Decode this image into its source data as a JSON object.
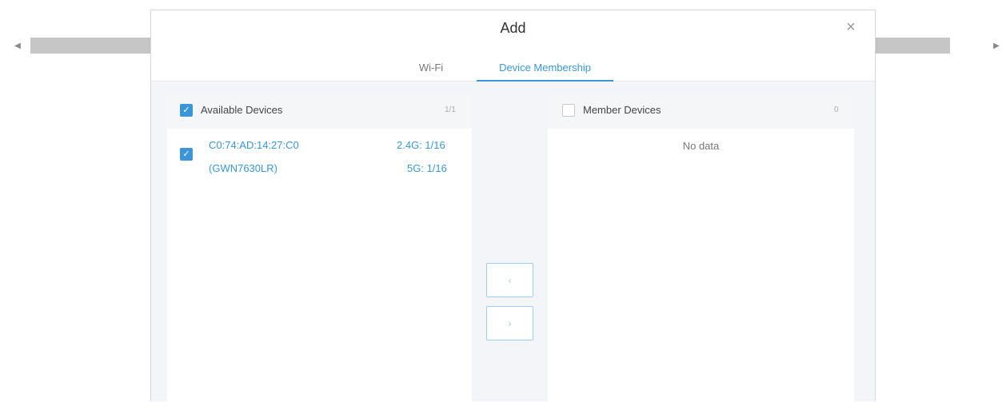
{
  "modal": {
    "title": "Add",
    "close_icon": "×",
    "tabs": [
      {
        "label": "Wi-Fi",
        "active": false
      },
      {
        "label": "Device Membership",
        "active": true
      }
    ]
  },
  "available": {
    "label": "Available Devices",
    "count": "1/1",
    "all_checked": true,
    "devices": [
      {
        "mac": "C0:74:AD:14:27:C0",
        "model": "(GWN7630LR)",
        "band24": "2.4G: 1/16",
        "band5": "5G: 1/16",
        "checked": true
      }
    ]
  },
  "member": {
    "label": "Member Devices",
    "count": "0",
    "all_checked": false,
    "empty_text": "No data"
  },
  "transfer": {
    "left_icon": "‹",
    "right_icon": "›"
  },
  "scrollbar": {
    "left_arrow": "◀",
    "right_arrow": "▶"
  },
  "colors": {
    "accent": "#3a96d8",
    "panel_bg": "#f3f5f8"
  }
}
